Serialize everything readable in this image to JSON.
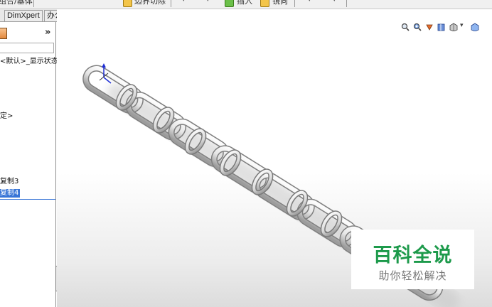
{
  "toolbar": {
    "item_left": "组合/基体",
    "item_boundary_cut": "边界切除",
    "item_insert": "插入",
    "item_reference": "镜向"
  },
  "tabs": [
    "DimXpert",
    "办公室产品"
  ],
  "panel": {
    "collapse_glyph": "»",
    "filter_value": "",
    "items": [
      {
        "label": "<默认>_显示状态",
        "selected": false
      },
      {
        "label": "定>",
        "selected": false
      },
      {
        "label": "复制3",
        "selected": false
      },
      {
        "label": "复制4",
        "selected": true
      }
    ]
  },
  "heads_up_icons": [
    "zoom-to-fit-icon",
    "zoom-area-icon",
    "previous-view-icon",
    "section-view-icon",
    "view-orientation-icon",
    "display-style-icon"
  ],
  "watermark": {
    "title": "百科全说",
    "subtitle": "助你轻松解决"
  },
  "colors": {
    "selection": "#3875d7",
    "watermark_green": "#1d9a4b",
    "chain_light": "#f2f2f2",
    "chain_dark": "#8a8a8a"
  }
}
